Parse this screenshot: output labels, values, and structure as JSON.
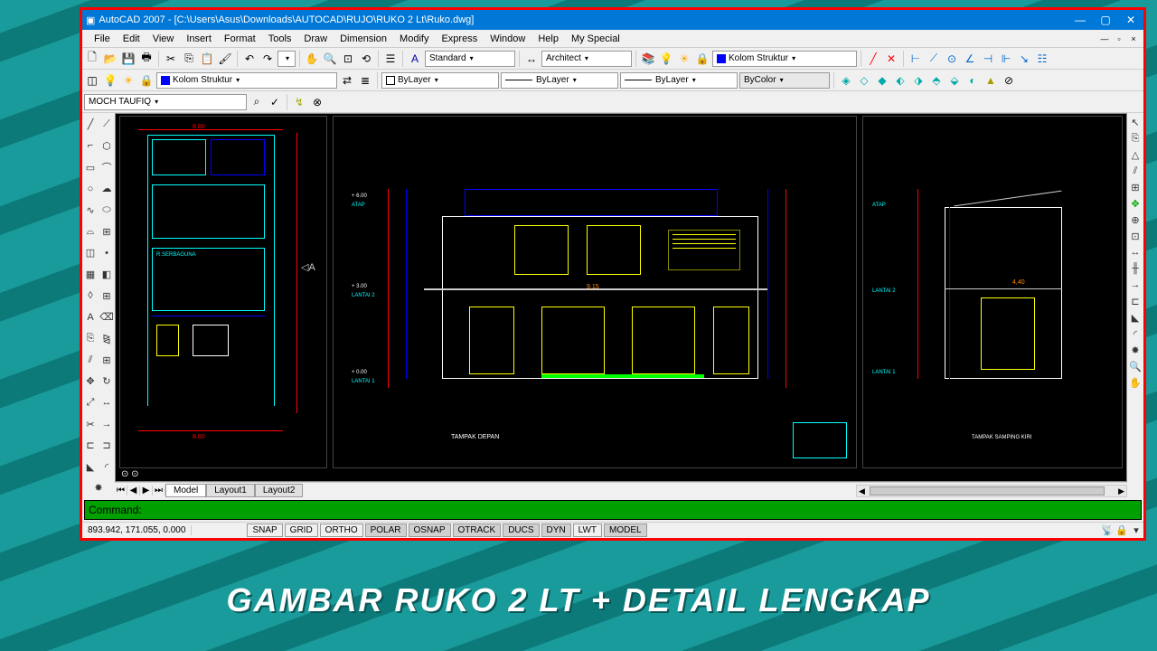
{
  "titlebar": {
    "app": "AutoCAD 2007",
    "file_path": "[C:\\Users\\Asus\\Downloads\\AUTOCAD\\RUJO\\RUKO 2 Lt\\Ruko.dwg]"
  },
  "menu": [
    "File",
    "Edit",
    "View",
    "Insert",
    "Format",
    "Tools",
    "Draw",
    "Dimension",
    "Modify",
    "Express",
    "Window",
    "Help",
    "My Special"
  ],
  "toolbar1": {
    "style_combo": "Standard",
    "dim_style": "Architect",
    "layer_combo": "Kolom Struktur"
  },
  "toolbar2": {
    "layer_combo2": "Kolom Struktur",
    "linetype": "ByLayer",
    "lineweight": "ByLayer",
    "plotstyle": "ByLayer",
    "color": "ByColor"
  },
  "toolbar3": {
    "text_input": "MOCH TAUFIQ"
  },
  "canvas": {
    "dim_800": "8.00",
    "dim_915": "9,15",
    "dim_440": "4,40",
    "label_atap": "ATAP",
    "label_lantai2": "LANTAI 2",
    "label_lantai1": "LANTAI 1",
    "elev1": "+ 6.00",
    "elev2": "+ 3.00",
    "elev3": "+ 0.00",
    "tampak": "TAMPAK DEPAN",
    "tampak2": "TAMPAK SAMPING KIRI"
  },
  "tabs": {
    "model": "Model",
    "layout1": "Layout1",
    "layout2": "Layout2"
  },
  "command": {
    "prompt": "Command:"
  },
  "status": {
    "coords": "893.942, 171.055, 0.000",
    "toggles": [
      "SNAP",
      "GRID",
      "ORTHO",
      "POLAR",
      "OSNAP",
      "OTRACK",
      "DUCS",
      "DYN",
      "LWT",
      "MODEL"
    ]
  },
  "caption": "GAMBAR RUKO 2 LT + DETAIL LENGKAP"
}
